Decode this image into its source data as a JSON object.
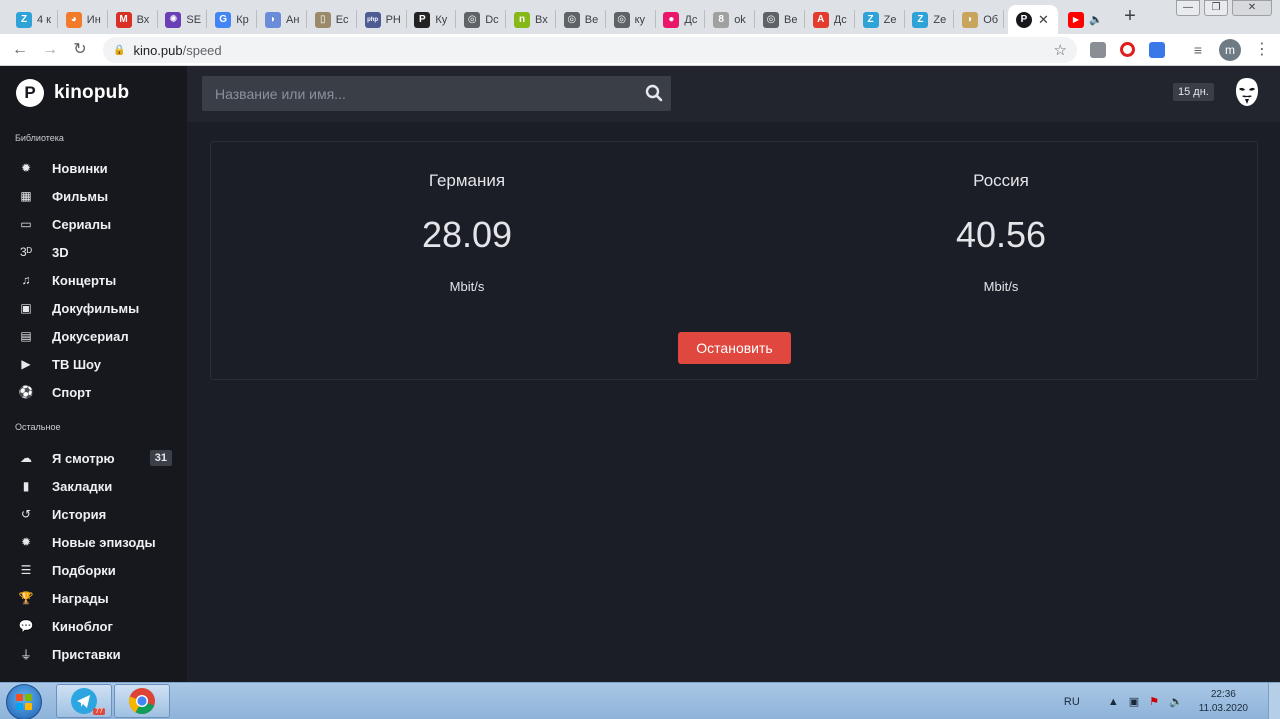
{
  "browser": {
    "tabs": [
      {
        "title": "4 к",
        "color": "#2fa3d8",
        "glyph": "Z"
      },
      {
        "title": "Ин",
        "color": "#f17b2a",
        "glyph": "◕"
      },
      {
        "title": "Вх",
        "color": "#d93025",
        "glyph": "M"
      },
      {
        "title": "SE",
        "color": "#6a3fb5",
        "glyph": "✺"
      },
      {
        "title": "Кр",
        "color": "#4285f4",
        "glyph": "G"
      },
      {
        "title": "Ан",
        "color": "#6b8cd6",
        "glyph": "◗"
      },
      {
        "title": "Ес",
        "color": "#9a8a6a",
        "glyph": "▯"
      },
      {
        "title": "PH",
        "color": "#4f5b93",
        "glyph": "php"
      },
      {
        "title": "Ку",
        "color": "#222222",
        "glyph": "P"
      },
      {
        "title": "Dc",
        "color": "#5f6368",
        "glyph": "◎"
      },
      {
        "title": "Вх",
        "color": "#86b817",
        "glyph": "n"
      },
      {
        "title": "Ве",
        "color": "#5f6368",
        "glyph": "◎"
      },
      {
        "title": "ку",
        "color": "#5f6368",
        "glyph": "◎"
      },
      {
        "title": "Дс",
        "color": "#e9166a",
        "glyph": "●"
      },
      {
        "title": "ok",
        "color": "#a0a0a0",
        "glyph": "8"
      },
      {
        "title": "Ве",
        "color": "#5f6368",
        "glyph": "◎"
      },
      {
        "title": "Дс",
        "color": "#e33b2e",
        "glyph": "A"
      },
      {
        "title": "Ze",
        "color": "#2fa3d8",
        "glyph": "Z"
      },
      {
        "title": "Ze",
        "color": "#2fa3d8",
        "glyph": "Z"
      },
      {
        "title": "Об",
        "color": "#c9a45c",
        "glyph": "◗"
      }
    ],
    "active_tab_glyph": "P",
    "active_tab_close": "✕",
    "youtube_tab_glyph": "▶",
    "youtube_tab_audio": "🔈",
    "new_tab": "+",
    "window_min": "—",
    "window_restore": "❐",
    "window_close": "✕",
    "back": "←",
    "forward": "→",
    "reload": "↻",
    "lock": "🔒",
    "url_host": "kino.pub",
    "url_path": "/speed",
    "star": "☆",
    "profile_letter": "m",
    "menu": "⋮"
  },
  "site": {
    "logo_mark": "P",
    "logo_text": "kinopub",
    "section_library": "Библиотека",
    "library_items": [
      {
        "label": "Новинки",
        "icon": "gear-icon",
        "glyph": "✹"
      },
      {
        "label": "Фильмы",
        "icon": "film-icon",
        "glyph": "▦"
      },
      {
        "label": "Сериалы",
        "icon": "tv-icon",
        "glyph": "▭"
      },
      {
        "label": "3D",
        "icon": "3d-icon",
        "glyph": "3ᴰ"
      },
      {
        "label": "Концерты",
        "icon": "music-icon",
        "glyph": "♫"
      },
      {
        "label": "Докуфильмы",
        "icon": "doc-film-icon",
        "glyph": "▣"
      },
      {
        "label": "Докусериал",
        "icon": "file-icon",
        "glyph": "▤"
      },
      {
        "label": "ТВ Шоу",
        "icon": "tv-show-icon",
        "glyph": "▶"
      },
      {
        "label": "Спорт",
        "icon": "ball-icon",
        "glyph": "⚽"
      }
    ],
    "section_other": "Остальное",
    "other_items": [
      {
        "label": "Я смотрю",
        "icon": "eye-icon",
        "glyph": "☁",
        "badge": "31"
      },
      {
        "label": "Закладки",
        "icon": "bookmark-icon",
        "glyph": "▮"
      },
      {
        "label": "История",
        "icon": "history-icon",
        "glyph": "↺"
      },
      {
        "label": "Новые эпизоды",
        "icon": "gear-icon",
        "glyph": "✹"
      },
      {
        "label": "Подборки",
        "icon": "list-icon",
        "glyph": "☰"
      },
      {
        "label": "Награды",
        "icon": "trophy-icon",
        "glyph": "🏆"
      },
      {
        "label": "Киноблог",
        "icon": "chat-icon",
        "glyph": "💬"
      },
      {
        "label": "Приставки",
        "icon": "plug-icon",
        "glyph": "⏚"
      }
    ],
    "search_placeholder": "Название или имя...",
    "subscription_days": "15 дн.",
    "speedtest": {
      "servers": [
        {
          "country": "Германия",
          "speed": "28.09",
          "unit": "Mbit/s"
        },
        {
          "country": "Россия",
          "speed": "40.56",
          "unit": "Mbit/s"
        }
      ],
      "stop_label": "Остановить"
    }
  },
  "taskbar": {
    "language": "RU",
    "tray_arrow": "▲",
    "tray_network": "▣",
    "tray_flag": "⚑",
    "tray_volume": "🔈",
    "time": "22:36",
    "date": "11.03.2020",
    "telegram_badge": "77"
  }
}
